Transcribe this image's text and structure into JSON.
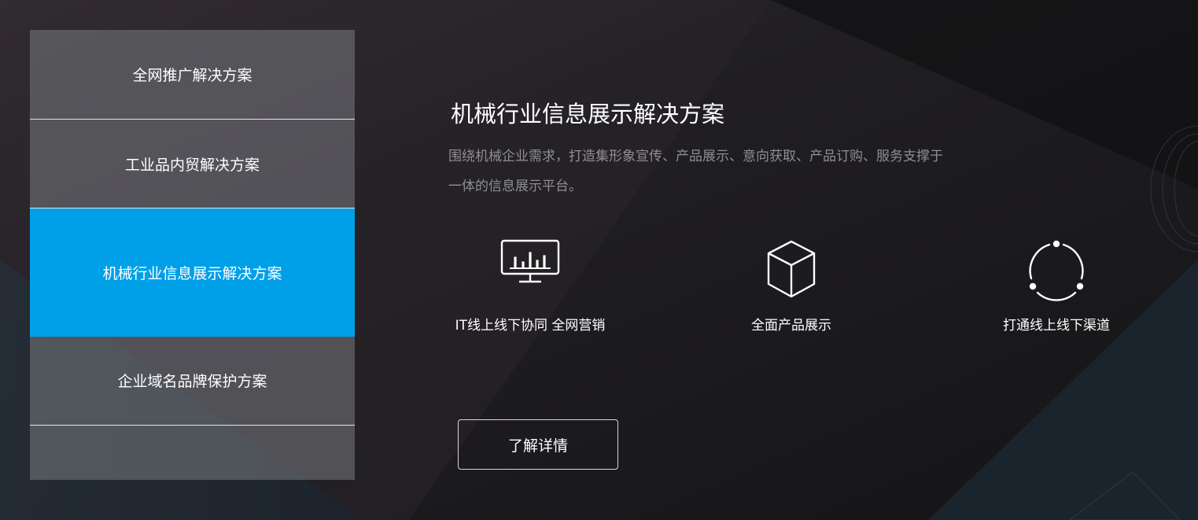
{
  "sidebar": {
    "items": [
      {
        "label": "全网推广解决方案"
      },
      {
        "label": "工业品内贸解决方案"
      },
      {
        "label": "机械行业信息展示解决方案"
      },
      {
        "label": "企业域名品牌保护方案"
      }
    ],
    "active_index": 2
  },
  "main": {
    "title": "机械行业信息展示解决方案",
    "description": "围绕机械企业需求，打造集形象宣传、产品展示、意向获取、产品订购、服务支撑于一体的信息展示平台。",
    "features": [
      {
        "icon": "monitor-chart-icon",
        "label": "IT线上线下协同 全网营销"
      },
      {
        "icon": "cube-icon",
        "label": "全面产品展示"
      },
      {
        "icon": "cycle-icon",
        "label": "打通线上线下渠道"
      }
    ],
    "detail_button": "了解详情"
  },
  "colors": {
    "accent": "#00a0e9",
    "background": "#161518",
    "text_muted": "#8e8f93"
  }
}
